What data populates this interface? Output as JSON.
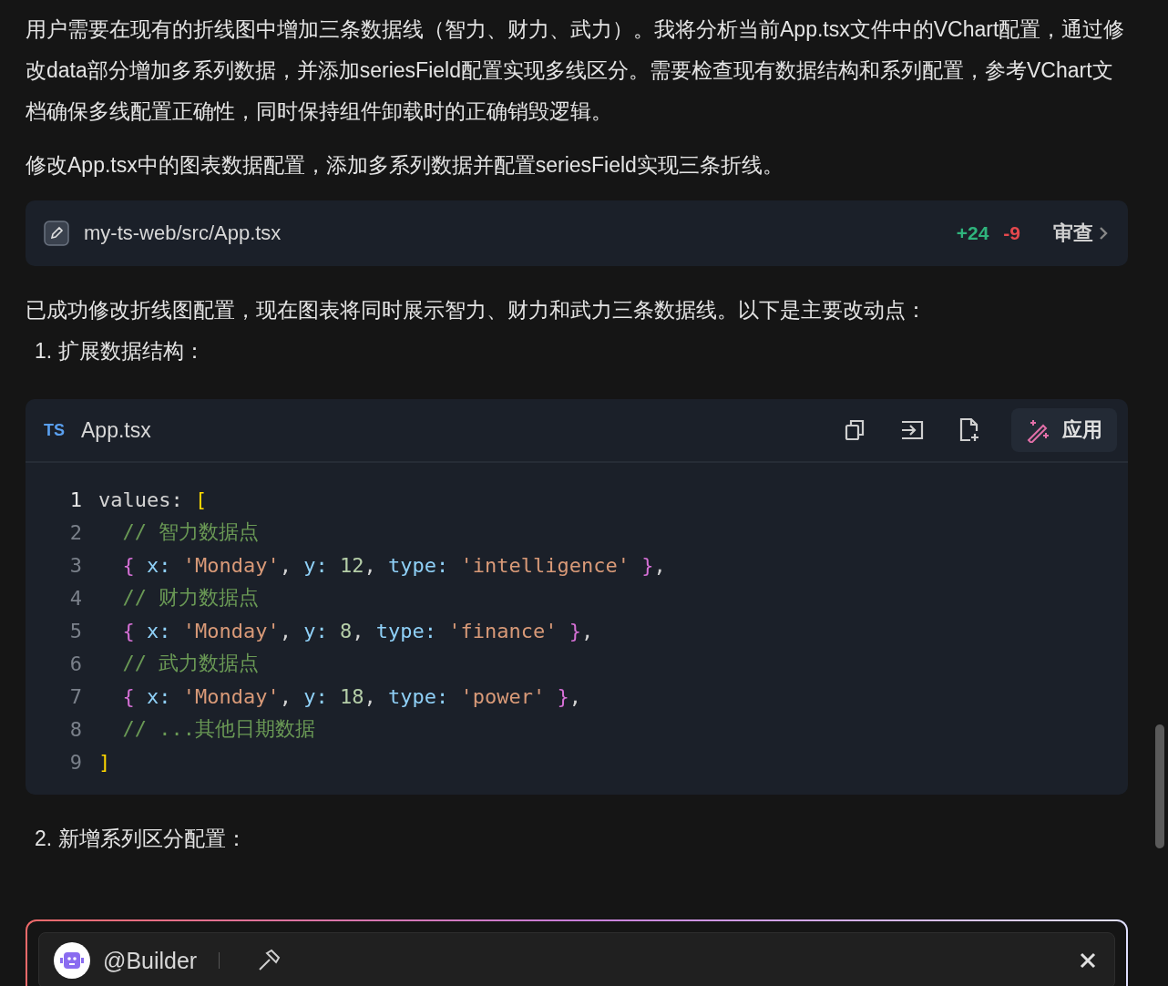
{
  "paragraphs": [
    "用户需要在现有的折线图中增加三条数据线（智力、财力、武力）。我将分析当前App.tsx文件中的VChart配置，通过修改data部分增加多系列数据，并添加seriesField配置实现多线区分。需要检查现有数据结构和系列配置，参考VChart文档确保多线配置正确性，同时保持组件卸载时的正确销毁逻辑。",
    "修改App.tsx中的图表数据配置，添加多系列数据并配置seriesField实现三条折线。"
  ],
  "file_change": {
    "path": "my-ts-web/src/App.tsx",
    "added": "+24",
    "removed": "-9",
    "review": "审查"
  },
  "summary": "已成功修改折线图配置，现在图表将同时展示智力、财力和武力三条数据线。以下是主要改动点：",
  "list_item_1": "1. 扩展数据结构：",
  "code_block": {
    "language": "TS",
    "filename": "App.tsx",
    "apply": "应用",
    "lines": [
      {
        "number": "1",
        "active": true,
        "tokens": [
          {
            "kind": "plain",
            "text": "values: "
          },
          {
            "kind": "bracket",
            "text": "["
          }
        ]
      },
      {
        "number": "2",
        "active": false,
        "tokens": [
          {
            "kind": "comment",
            "text": "  // 智力数据点"
          }
        ]
      },
      {
        "number": "3",
        "active": false,
        "tokens": [
          {
            "kind": "brace",
            "text": "  {"
          },
          {
            "kind": "key",
            "text": " x:"
          },
          {
            "kind": "string",
            "text": " 'Monday'"
          },
          {
            "kind": "plain",
            "text": ","
          },
          {
            "kind": "key",
            "text": " y:"
          },
          {
            "kind": "number",
            "text": " 12"
          },
          {
            "kind": "plain",
            "text": ","
          },
          {
            "kind": "key",
            "text": " type:"
          },
          {
            "kind": "string",
            "text": " 'intelligence'"
          },
          {
            "kind": "brace",
            "text": " }"
          },
          {
            "kind": "plain",
            "text": ","
          }
        ]
      },
      {
        "number": "4",
        "active": false,
        "tokens": [
          {
            "kind": "comment",
            "text": "  // 财力数据点"
          }
        ]
      },
      {
        "number": "5",
        "active": false,
        "tokens": [
          {
            "kind": "brace",
            "text": "  {"
          },
          {
            "kind": "key",
            "text": " x:"
          },
          {
            "kind": "string",
            "text": " 'Monday'"
          },
          {
            "kind": "plain",
            "text": ","
          },
          {
            "kind": "key",
            "text": " y:"
          },
          {
            "kind": "number",
            "text": " 8"
          },
          {
            "kind": "plain",
            "text": ","
          },
          {
            "kind": "key",
            "text": " type:"
          },
          {
            "kind": "string",
            "text": " 'finance'"
          },
          {
            "kind": "brace",
            "text": " }"
          },
          {
            "kind": "plain",
            "text": ","
          }
        ]
      },
      {
        "number": "6",
        "active": false,
        "tokens": [
          {
            "kind": "comment",
            "text": "  // 武力数据点"
          }
        ]
      },
      {
        "number": "7",
        "active": false,
        "tokens": [
          {
            "kind": "brace",
            "text": "  {"
          },
          {
            "kind": "key",
            "text": " x:"
          },
          {
            "kind": "string",
            "text": " 'Monday'"
          },
          {
            "kind": "plain",
            "text": ","
          },
          {
            "kind": "key",
            "text": " y:"
          },
          {
            "kind": "number",
            "text": " 18"
          },
          {
            "kind": "plain",
            "text": ","
          },
          {
            "kind": "key",
            "text": " type:"
          },
          {
            "kind": "string",
            "text": " 'power'"
          },
          {
            "kind": "brace",
            "text": " }"
          },
          {
            "kind": "plain",
            "text": ","
          }
        ]
      },
      {
        "number": "8",
        "active": false,
        "tokens": [
          {
            "kind": "comment",
            "text": "  // ...其他日期数据"
          }
        ]
      },
      {
        "number": "9",
        "active": false,
        "tokens": [
          {
            "kind": "bracket",
            "text": "]"
          }
        ]
      }
    ]
  },
  "list_item_2": "2. 新增系列区分配置：",
  "composer": {
    "mention": "@Builder"
  }
}
